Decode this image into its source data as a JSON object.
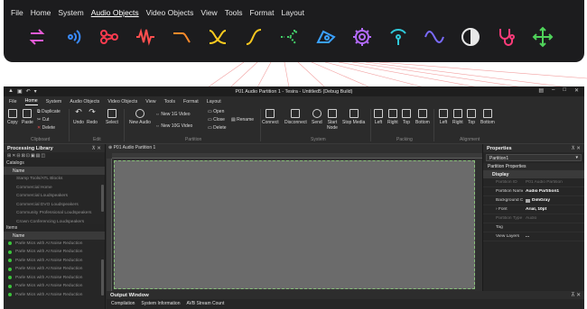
{
  "showcase": {
    "menu": [
      "File",
      "Home",
      "System",
      "Audio Objects",
      "Video Objects",
      "View",
      "Tools",
      "Format",
      "Layout"
    ],
    "active_menu": "Audio Objects",
    "icons": [
      {
        "name": "swap-arrows-icon",
        "color": "#e65bd6"
      },
      {
        "name": "signal-wave-icon",
        "color": "#3a8bff"
      },
      {
        "name": "scissors-link-icon",
        "color": "#ff3b4f"
      },
      {
        "name": "waveform-icon",
        "color": "#ff4f4f"
      },
      {
        "name": "low-pass-curve-icon",
        "color": "#ff8a2a"
      },
      {
        "name": "crossover-icon",
        "color": "#ffcc1f"
      },
      {
        "name": "s-curve-icon",
        "color": "#f6c71f"
      },
      {
        "name": "routing-arrow-icon",
        "color": "#44d26a"
      },
      {
        "name": "loudspeaker-icon",
        "color": "#3aa0ff"
      },
      {
        "name": "gear-icon",
        "color": "#b46bff"
      },
      {
        "name": "probe-icon",
        "color": "#2fc8d8"
      },
      {
        "name": "sine-wave-icon",
        "color": "#7a6bff"
      },
      {
        "name": "contrast-circle-icon",
        "color": "#e8e8e8"
      },
      {
        "name": "stethoscope-icon",
        "color": "#ff3b7a"
      },
      {
        "name": "crosshair-move-icon",
        "color": "#4fd25a"
      }
    ]
  },
  "app": {
    "title": "P01 Audio Partition 1 - Tesira - Untitled5 (Debug Build)",
    "menu": [
      "File",
      "Home",
      "System",
      "Audio Objects",
      "Video Objects",
      "View",
      "Tools",
      "Format",
      "Layout"
    ],
    "active_menu": "Home",
    "ribbon": {
      "copy": "Copy",
      "paste": "Paste",
      "duplicate": "Duplicate",
      "cut": "Cut",
      "delete": "Delete",
      "undo": "Undo",
      "redo": "Redo",
      "select": "Select",
      "new_audio": "New Audio",
      "new_1g_video": "New 1G Video",
      "new_10g_video": "New 10G Video",
      "open": "Open",
      "close": "Close",
      "rename": "Rename",
      "delete2": "Delete",
      "connect": "Connect",
      "disconnect": "Disconnect",
      "send": "Send",
      "start_node": "Start\nNode",
      "stop_media": "Stop Media",
      "pk_left": "Left",
      "pk_right": "Right",
      "pk_top": "Top",
      "pk_bottom": "Bottom",
      "al_left": "Left",
      "al_right": "Right",
      "al_top": "Top",
      "al_bottom": "Bottom",
      "groups": {
        "clipboard": "Clipboard",
        "edit": "Edit",
        "partition": "Partition",
        "system": "System",
        "packing": "Packing",
        "alignment": "Alignment"
      }
    },
    "processing_library": {
      "title": "Processing Library",
      "catalogs_label": "Catalogs",
      "name_header": "Name",
      "catalogs": [
        "Stamp Tools/ATL Blocks",
        "Commercial Home",
        "Commercial Loudspeakers",
        "Commercial DVO Loudspeakers",
        "Community Professional Loudspeakers",
        "Crown Conferencing Loudspeakers"
      ],
      "items_label": "Items",
      "items_header": "Name",
      "items": [
        "Parle Mics with AI Noise Reduction",
        "Parle Mics with AI Noise Reduction",
        "Parle Mics with AI Noise Reduction",
        "Parle Mics with AI Noise Reduction",
        "Parle Mics with AI Noise Reduction",
        "Parle Mics with AI Noise Reduction",
        "Parle Mics with AI Noise Reduction"
      ]
    },
    "document_tab": "P01 Audio Partition 1",
    "output": {
      "title": "Output Window",
      "tabs": [
        "Compilation",
        "System Information",
        "AVB Stream Count"
      ]
    },
    "properties": {
      "title": "Properties",
      "selected": "Partition1",
      "subheader": "Partition Properties",
      "category": "Display",
      "rows": [
        {
          "k": "Partition ID",
          "v": "P01 Audio Partition",
          "dim": true
        },
        {
          "k": "Partition Name",
          "v": "Audio Partition1",
          "dim": false
        },
        {
          "k": "Background Col..",
          "v": "DimGray",
          "dim": false,
          "swatch": true
        },
        {
          "k": "Font",
          "v": "Arial, 10pt",
          "dim": false
        },
        {
          "k": "Partition Type",
          "v": "Audio",
          "dim": true
        },
        {
          "k": "Tag",
          "v": "",
          "dim": false
        },
        {
          "k": "View Layers",
          "v": "...",
          "dim": false
        }
      ]
    }
  }
}
